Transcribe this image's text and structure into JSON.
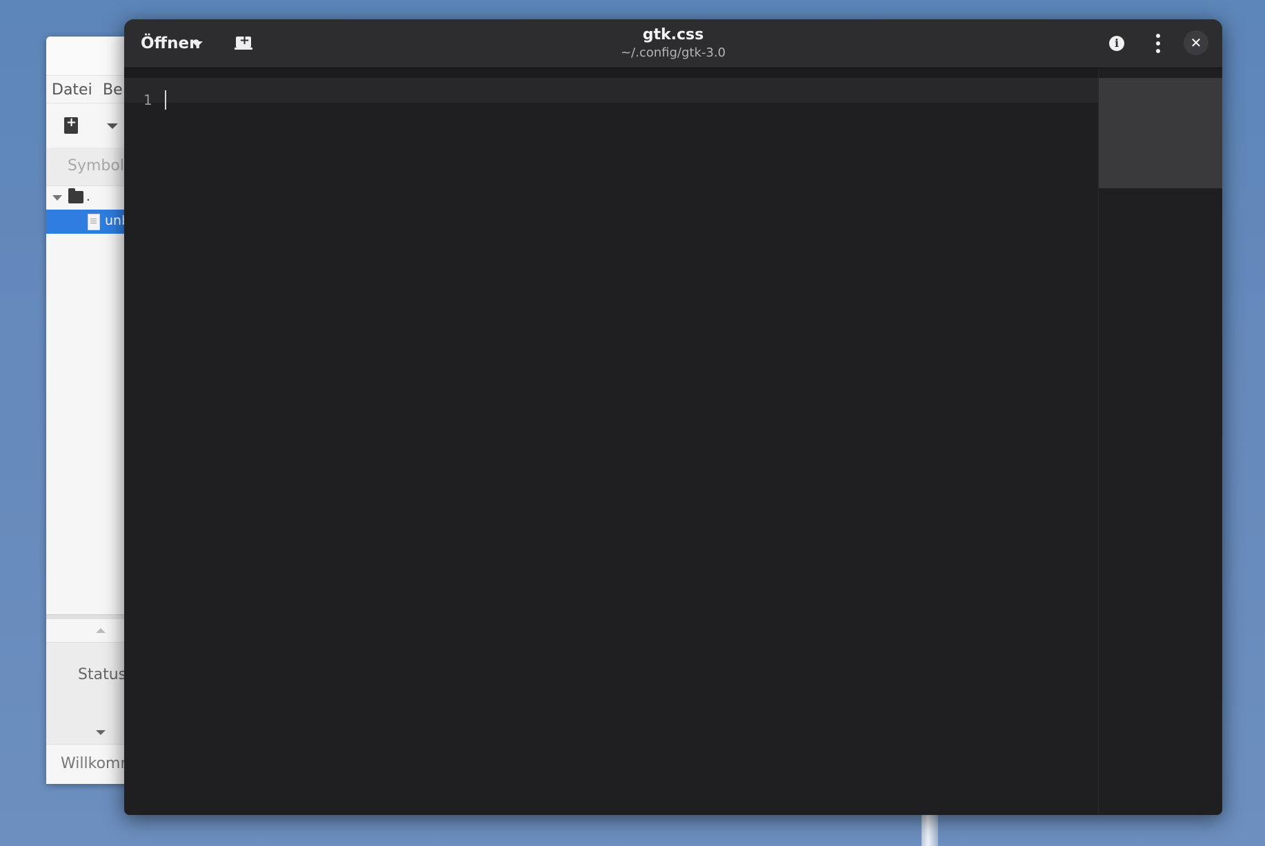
{
  "background_window": {
    "menu": [
      "Datei",
      "Be"
    ],
    "sidebar_tab": "Symbol",
    "tree": {
      "folder_label": ".",
      "file_label": "unb"
    },
    "status_label": "Status",
    "statusbar_text": "Willkomm"
  },
  "editor_window": {
    "open_button": "Öffnen",
    "title": "gtk.css",
    "subtitle": "~/.config/gtk-3.0",
    "line_numbers": [
      "1"
    ],
    "icons": {
      "open_dropdown": "chevron-down-icon",
      "new_tab": "new-tab-icon",
      "info": "info-icon",
      "menu": "kebab-menu-icon",
      "close": "close-icon"
    }
  },
  "colors": {
    "desktop": "#6589bb",
    "header": "#2d2d30",
    "editor_bg": "#1f1f21",
    "selection": "#2f7de1"
  }
}
